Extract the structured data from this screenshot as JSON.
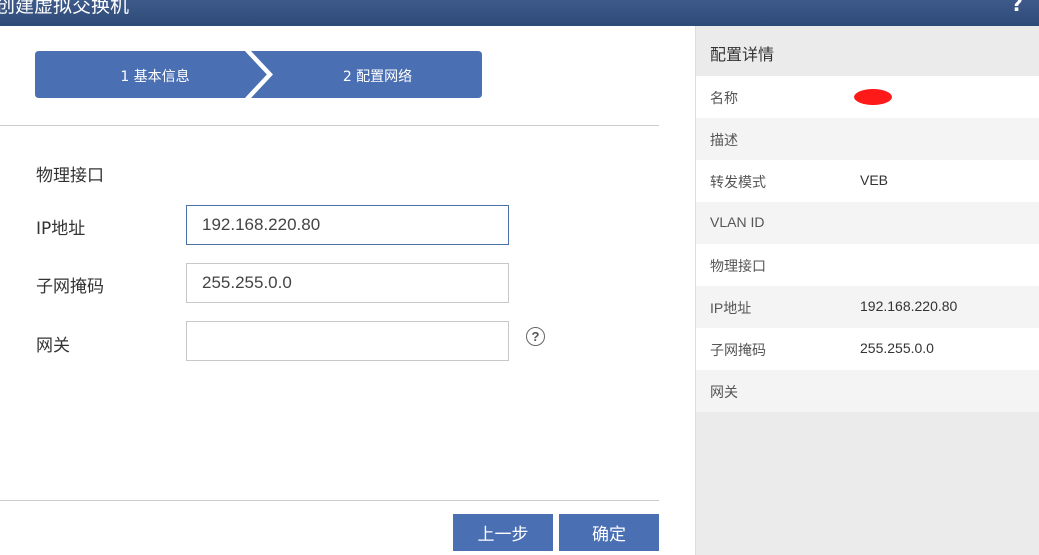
{
  "window": {
    "title": "创建虚拟交换机",
    "help_icon": "help-icon"
  },
  "wizard": {
    "steps": [
      {
        "label": "1 基本信息"
      },
      {
        "label": "2 配置网络"
      }
    ],
    "colors": {
      "step_active": "#4a6fb3"
    }
  },
  "form": {
    "physical_interface_label": "物理接口",
    "ip_label": "IP地址",
    "ip_value": "192.168.220.80",
    "mask_label": "子网掩码",
    "mask_value": "255.255.0.0",
    "gateway_label": "网关",
    "gateway_value": "",
    "gateway_help_icon": "question-circle-icon"
  },
  "buttons": {
    "prev_label": "上一步",
    "ok_label": "确定"
  },
  "details": {
    "header": "配置详情",
    "rows": [
      {
        "key": "名称",
        "value": ""
      },
      {
        "key": "描述",
        "value": ""
      },
      {
        "key": "转发模式",
        "value": "VEB"
      },
      {
        "key": "VLAN ID",
        "value": ""
      },
      {
        "key": "物理接口",
        "value": ""
      },
      {
        "key": "IP地址",
        "value": "192.168.220.80"
      },
      {
        "key": "子网掩码",
        "value": "255.255.0.0"
      },
      {
        "key": "网关",
        "value": ""
      }
    ]
  }
}
